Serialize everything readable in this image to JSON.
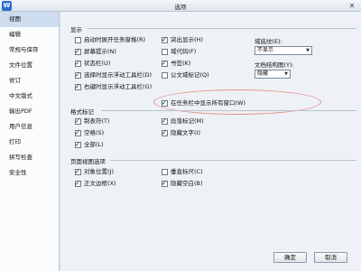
{
  "window": {
    "title": "选项",
    "app_icon": "W"
  },
  "sidebar": {
    "items": [
      {
        "label": "视图"
      },
      {
        "label": "编辑"
      },
      {
        "label": "常规与保存"
      },
      {
        "label": "文件位置"
      },
      {
        "label": "修订"
      },
      {
        "label": "中文版式"
      },
      {
        "label": "输出PDF"
      },
      {
        "label": "用户信息"
      },
      {
        "label": "打印"
      },
      {
        "label": "拼写检查"
      },
      {
        "label": "安全性"
      }
    ],
    "active_index": 0
  },
  "display": {
    "title": "显示",
    "left": [
      {
        "label": "启动时展开任务窗格(R)",
        "checked": false
      },
      {
        "label": "屏幕提示(N)",
        "checked": true
      },
      {
        "label": "状态栏(U)",
        "checked": true
      },
      {
        "label": "选择时显示浮动工具栏(D)",
        "checked": true
      },
      {
        "label": "右键时显示浮动工具栏(G)",
        "checked": true
      }
    ],
    "right": [
      {
        "label": "突出显示(H)",
        "checked": true
      },
      {
        "label": "域代码(F)",
        "checked": false
      },
      {
        "label": "书签(K)",
        "checked": true
      },
      {
        "label": "公文域标记(Q)",
        "checked": false
      },
      {
        "label": "在任务栏中显示所有窗口(W)",
        "checked": true
      }
    ],
    "field_shading": {
      "label": "域底纹(E):",
      "value": "不显示"
    },
    "doc_structure": {
      "label": "文档结构图(Y):",
      "value": "隐藏"
    }
  },
  "format_marks": {
    "title": "格式标记",
    "left": [
      {
        "label": "制表符(T)",
        "checked": true
      },
      {
        "label": "空格(S)",
        "checked": true
      },
      {
        "label": "全部(L)",
        "checked": true
      }
    ],
    "right": [
      {
        "label": "段落标记(M)",
        "checked": true
      },
      {
        "label": "隐藏文字(I)",
        "checked": true
      }
    ]
  },
  "page_view": {
    "title": "页面视图选项",
    "left": [
      {
        "label": "对象位置(J)",
        "checked": true
      },
      {
        "label": "正文边框(X)",
        "checked": true
      }
    ],
    "right": [
      {
        "label": "垂直标尺(C)",
        "checked": false
      },
      {
        "label": "隐藏空白(B)",
        "checked": true
      }
    ]
  },
  "buttons": {
    "ok": "确定",
    "cancel": "取消"
  },
  "highlight_color": "#e39490"
}
